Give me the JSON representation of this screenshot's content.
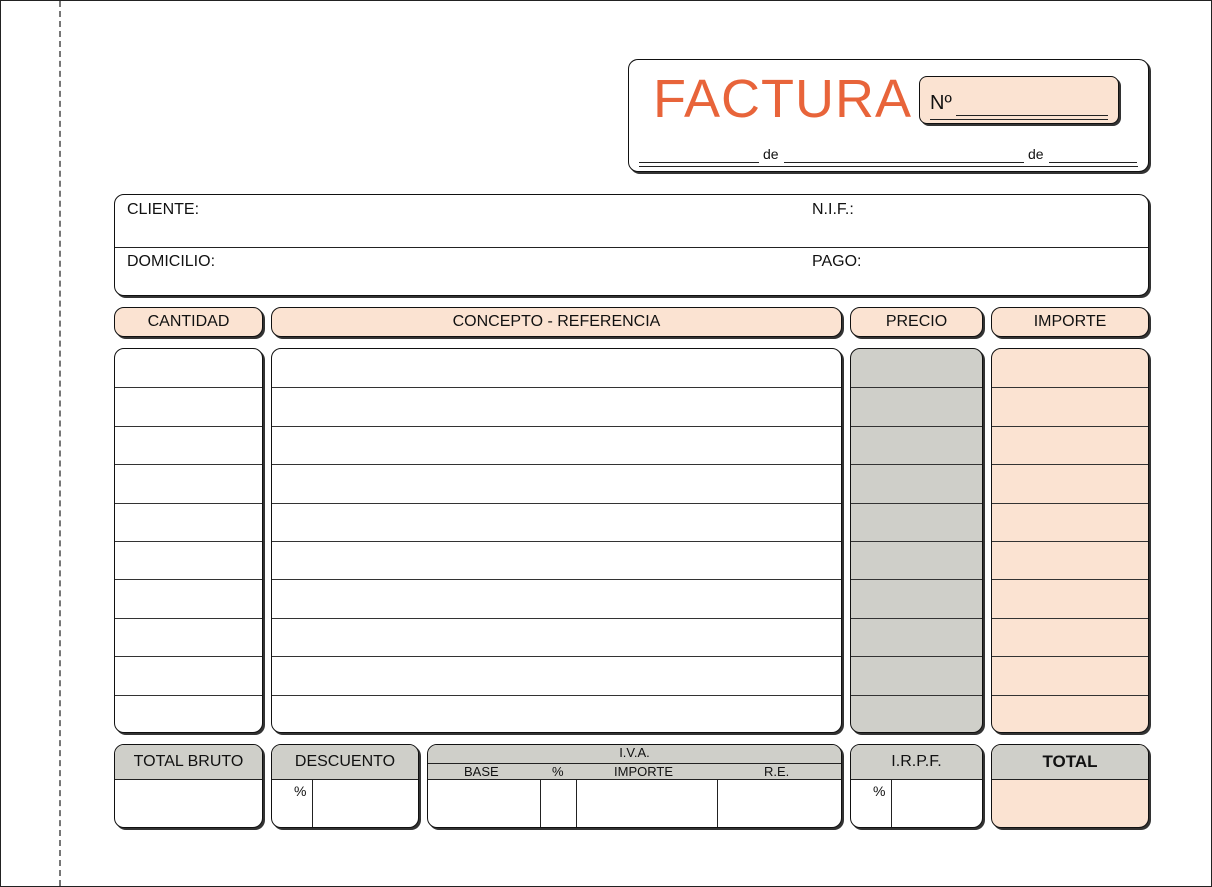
{
  "header": {
    "title": "FACTURA",
    "number_label": "Nº",
    "date_de_1": "de",
    "date_de_2": "de"
  },
  "client": {
    "cliente_label": "CLIENTE:",
    "nif_label": "N.I.F.:",
    "domicilio_label": "DOMICILIO:",
    "pago_label": "PAGO:"
  },
  "columns": {
    "cantidad": "CANTIDAD",
    "concepto": "CONCEPTO - REFERENCIA",
    "precio": "PRECIO",
    "importe": "IMPORTE"
  },
  "item_rows": 10,
  "totals": {
    "total_bruto": "TOTAL BRUTO",
    "descuento": "DESCUENTO",
    "descuento_pct": "%",
    "iva": "I.V.A.",
    "iva_base": "BASE",
    "iva_pct": "%",
    "iva_importe": "IMPORTE",
    "iva_re": "R.E.",
    "irpf": "I.R.P.F.",
    "irpf_pct": "%",
    "total": "TOTAL"
  },
  "colors": {
    "accent": "#e8643a",
    "peach": "#fbe3d2",
    "grey": "#cfcfc9"
  }
}
